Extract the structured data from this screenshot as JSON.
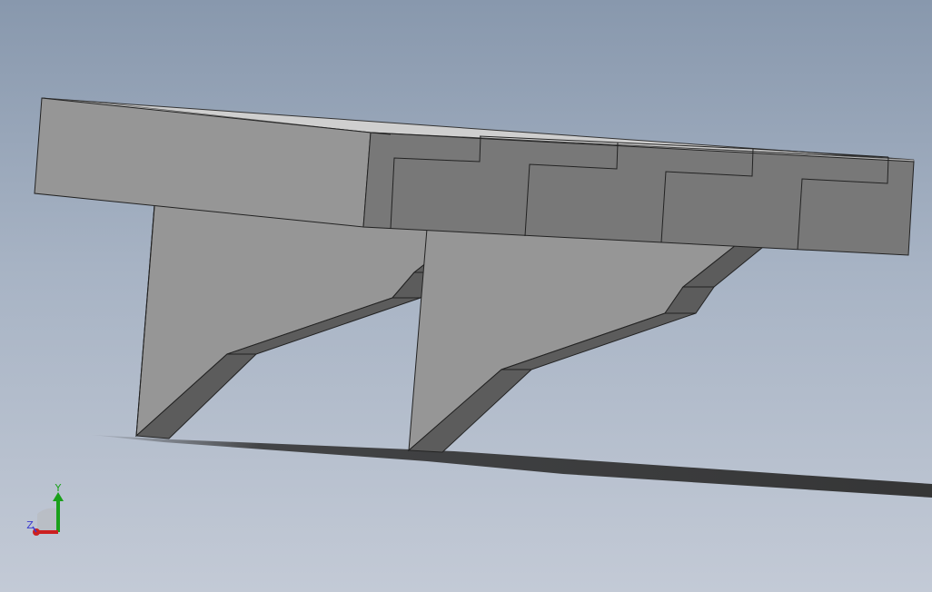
{
  "viewport": {
    "background_top": "#8898ad",
    "background_bottom": "#c3cad6"
  },
  "model": {
    "face_light": "#969696",
    "face_mid": "#7a7a7a",
    "face_dark": "#5c5c5c",
    "face_top": "#cfcfcf",
    "edge": "#222222",
    "shadow": "#2e2e2e"
  },
  "triad": {
    "x_label": "",
    "y_label": "Y",
    "z_label": "Z",
    "x_color": "#cc2020",
    "y_color": "#1aa01a",
    "z_color": "#3b3bd0"
  }
}
